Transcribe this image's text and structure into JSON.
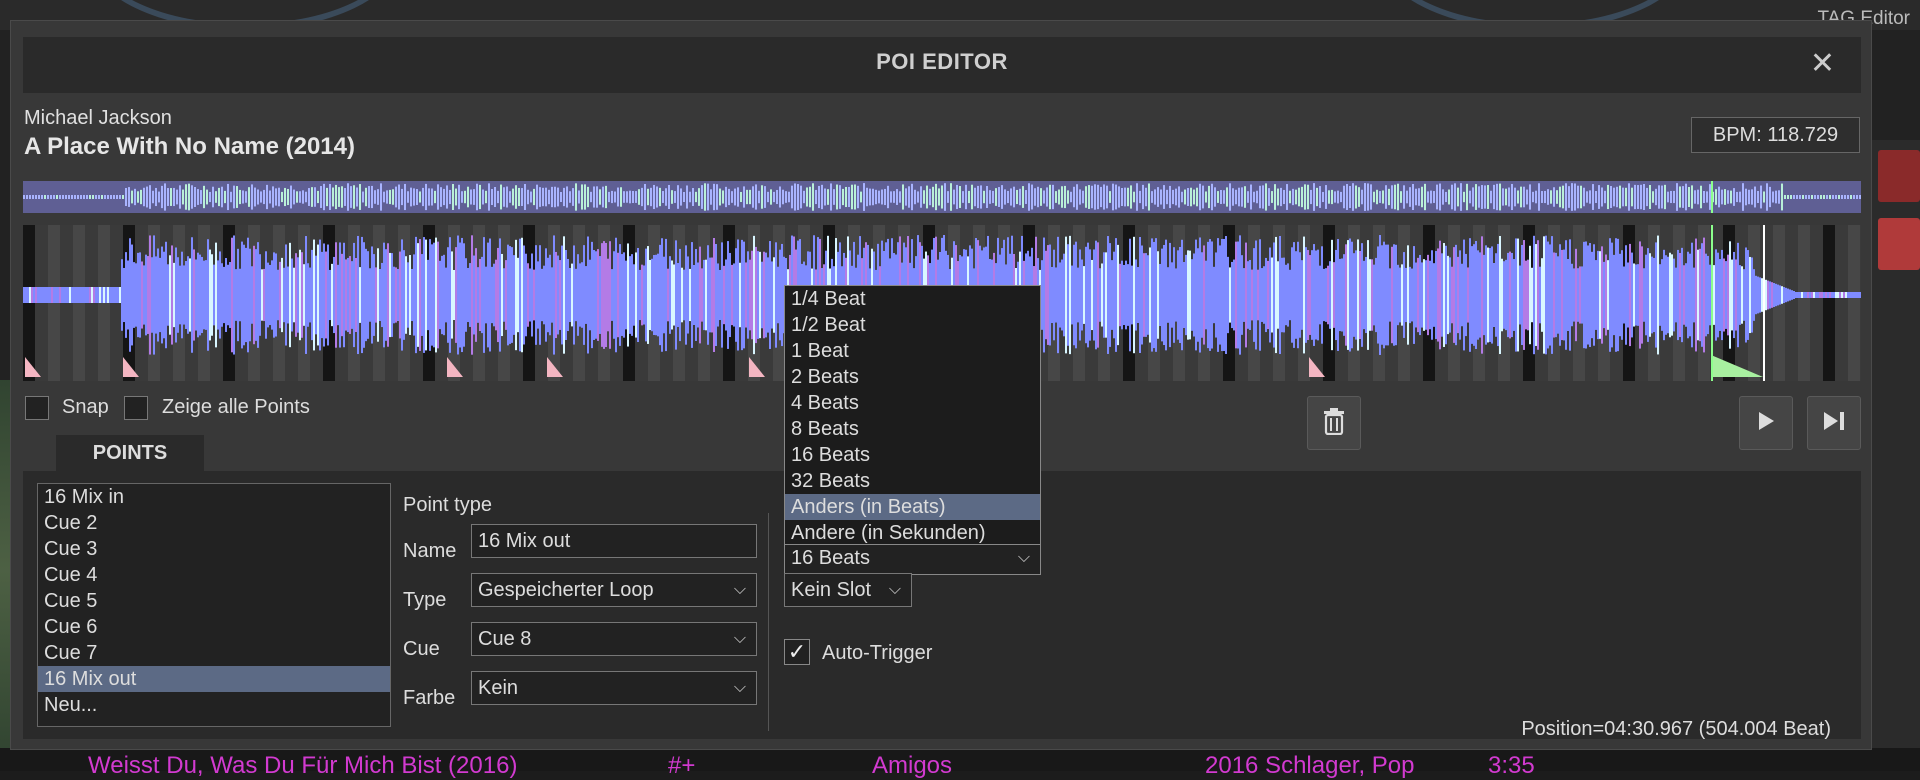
{
  "background": {
    "tag_editor_label": "TAG Editor",
    "track_title": "Weisst Du, Was Du Für Mich Bist (2016)",
    "track_key": "#+",
    "track_artist": "Amigos",
    "track_genre": "2016 Schlager, Pop",
    "track_duration": "3:35"
  },
  "dialog": {
    "title": "POI EDITOR",
    "close_glyph": "✕"
  },
  "track": {
    "artist": "Michael Jackson",
    "title": "A Place With No Name (2014)",
    "bpm": "BPM: 118.729"
  },
  "options": {
    "snap_label": "Snap",
    "show_all_label": "Zeige alle Points"
  },
  "points": {
    "tab_label": "POINTS",
    "items": [
      {
        "label": "16 Mix in",
        "selected": false
      },
      {
        "label": "Cue 2",
        "selected": false
      },
      {
        "label": "Cue 3",
        "selected": false
      },
      {
        "label": "Cue 4",
        "selected": false
      },
      {
        "label": "Cue 5",
        "selected": false
      },
      {
        "label": "Cue 6",
        "selected": false
      },
      {
        "label": "Cue 7",
        "selected": false
      },
      {
        "label": "16 Mix out",
        "selected": true
      },
      {
        "label": "Neu...",
        "selected": false
      }
    ]
  },
  "form": {
    "point_type_label": "Point type",
    "name_label": "Name",
    "name_value": "16 Mix out",
    "type_label": "Type",
    "type_value": "Gespeicherter Loop",
    "cue_label": "Cue",
    "cue_value": "Cue 8",
    "color_label": "Farbe",
    "color_value": "Kein",
    "length_value": "16 Beats",
    "slot_value": "Kein Slot",
    "auto_trigger_label": "Auto-Trigger",
    "auto_trigger_checked": "✓"
  },
  "dropdown": {
    "options": [
      {
        "label": "1/4 Beat",
        "highlighted": false
      },
      {
        "label": "1/2 Beat",
        "highlighted": false
      },
      {
        "label": "1 Beat",
        "highlighted": false
      },
      {
        "label": "2 Beats",
        "highlighted": false
      },
      {
        "label": "4 Beats",
        "highlighted": false
      },
      {
        "label": "8 Beats",
        "highlighted": false
      },
      {
        "label": "16 Beats",
        "highlighted": false
      },
      {
        "label": "32 Beats",
        "highlighted": false
      },
      {
        "label": "Anders (in Beats)",
        "highlighted": true
      },
      {
        "label": "Andere (in Sekunden)",
        "highlighted": false
      }
    ]
  },
  "status": {
    "position": "Position=04:30.967 (504.004 Beat)"
  },
  "colors": {
    "selection": "#5c6a85",
    "waveform": "#7f8bff",
    "cue_marker": "#f4b6c2",
    "loop_marker": "#a8f0a0"
  },
  "icons": {
    "delete": "trash-icon",
    "play": "play-icon",
    "skip": "skip-to-end-icon",
    "close": "close-icon"
  }
}
